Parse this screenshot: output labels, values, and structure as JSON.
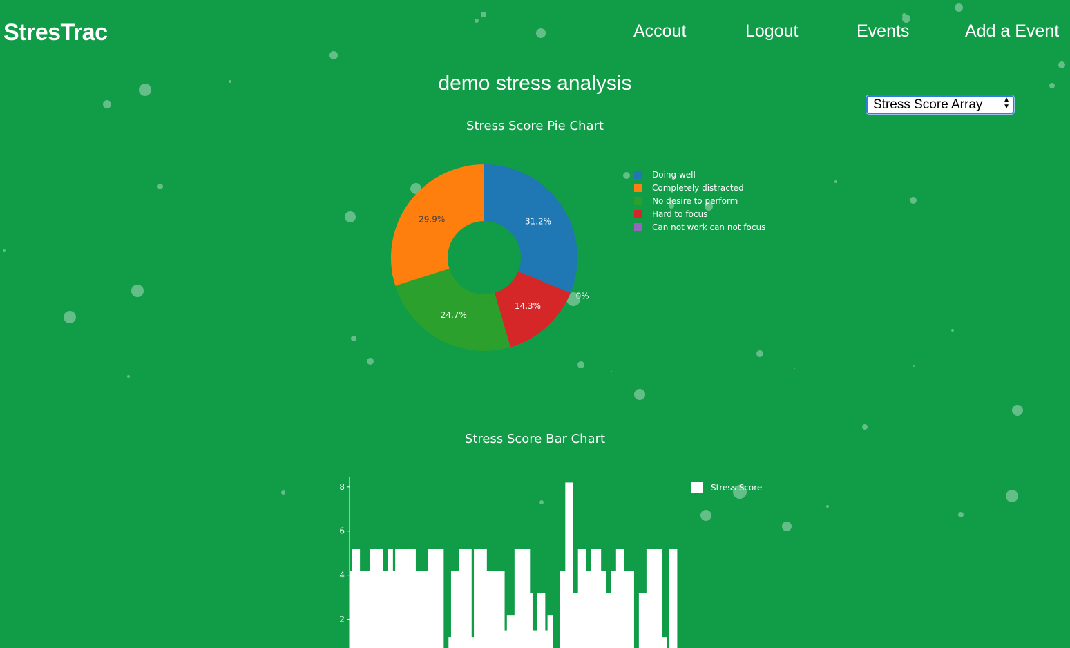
{
  "brand": "StresTrac",
  "nav": [
    "Accout",
    "Logout",
    "Events",
    "Add a Event"
  ],
  "page_title": "demo stress analysis",
  "view_select": {
    "selected": "Stress Score Array"
  },
  "colors": {
    "background": "#119c48",
    "select_border": "#2f7de1"
  },
  "chart_data": [
    {
      "type": "pie",
      "title": "Stress Score Pie Chart",
      "hole": true,
      "labels": [
        "Doing well",
        "Completely distracted",
        "No desire to perform",
        "Hard to focus",
        "Can not work can not focus"
      ],
      "values": [
        31.2,
        29.9,
        24.7,
        14.3,
        0
      ],
      "value_labels": [
        "31.2%",
        "29.9%",
        "24.7%",
        "14.3%",
        "0%"
      ],
      "colors": [
        "#1f77b4",
        "#ff7f0e",
        "#2ca02c",
        "#d62728",
        "#9467bd"
      ],
      "slice_order": [
        "Doing well",
        "Can not work can not focus",
        "Hard to focus",
        "No desire to perform",
        "Completely distracted"
      ],
      "legend": "right"
    },
    {
      "type": "bar",
      "title": "Stress Score Bar Chart",
      "series": [
        {
          "name": "Stress Score",
          "values": [
            4.2,
            5.2,
            5.2,
            5.2,
            4.2,
            4.2,
            4.2,
            4.2,
            5.2,
            5.2,
            5.2,
            5.2,
            5.2,
            4.2,
            4.2,
            5.2,
            5.2,
            4.2,
            5.2,
            5.2,
            5.2,
            5.2,
            5.2,
            5.2,
            5.2,
            5.2,
            4.2,
            4.2,
            4.2,
            4.2,
            4.2,
            5.2,
            5.2,
            5.2,
            5.2,
            5.2,
            5.2,
            0,
            0.4,
            1.2,
            4.2,
            4.2,
            4.2,
            5.2,
            5.2,
            5.2,
            5.2,
            5.2,
            1.2,
            5.2,
            5.2,
            5.2,
            5.2,
            5.2,
            4.2,
            4.2,
            4.2,
            4.2,
            4.2,
            4.2,
            4.2,
            1.5,
            2.2,
            2.2,
            2.2,
            5.2,
            5.2,
            5.2,
            5.2,
            5.2,
            5.2,
            3.2,
            1.5,
            1.5,
            3.2,
            3.2,
            3.2,
            1.5,
            2.2,
            2.2,
            0,
            0,
            0,
            4.2,
            4.2,
            8.2,
            8.2,
            8.2,
            3.2,
            3.2,
            5.2,
            5.2,
            5.2,
            4.2,
            4.2,
            5.2,
            5.2,
            5.2,
            5.2,
            4.2,
            4.2,
            3.2,
            3.2,
            4.2,
            4.2,
            5.2,
            5.2,
            5.2,
            4.2,
            4.2,
            4.2,
            4.2,
            0,
            0,
            3.2,
            3.2,
            3.2,
            5.2,
            5.2,
            5.2,
            5.2,
            5.2,
            5.2,
            1.2,
            1.2,
            0,
            5.2,
            5.2,
            5.2
          ]
        }
      ],
      "y_ticks": [
        "2",
        "4",
        "6",
        "8"
      ],
      "ylim": [
        0,
        8.5
      ],
      "legend": "top-right"
    }
  ]
}
